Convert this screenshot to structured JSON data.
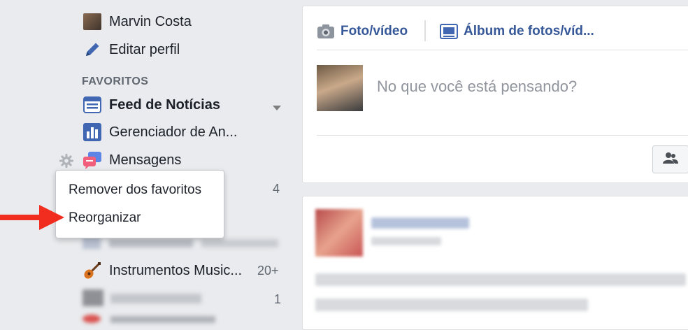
{
  "sidebar": {
    "profile": {
      "name": "Marvin Costa",
      "edit_label": "Editar perfil"
    },
    "favorites_title": "FAVORITOS",
    "items": [
      {
        "label": "Feed de Notícias",
        "icon": "news-feed-icon"
      },
      {
        "label": "Gerenciador de An...",
        "icon": "ads-manager-icon"
      },
      {
        "label": "Mensagens",
        "icon": "messages-icon",
        "count": "4"
      },
      {
        "label": "Instrumentos Music...",
        "icon": "guitar-icon",
        "count": "20+"
      },
      {
        "count": "1"
      }
    ]
  },
  "context_menu": {
    "items": [
      {
        "label": "Remover dos favoritos"
      },
      {
        "label": "Reorganizar"
      }
    ]
  },
  "composer": {
    "tabs": [
      {
        "label": "Foto/vídeo",
        "icon": "camera-icon"
      },
      {
        "label": "Álbum de fotos/víd...",
        "icon": "photo-album-icon"
      }
    ],
    "placeholder": "No que você está pensando?"
  },
  "colors": {
    "background": "#e9ebee",
    "link_blue": "#365899",
    "arrow_red": "#f02d1e",
    "muted": "#90949c"
  }
}
